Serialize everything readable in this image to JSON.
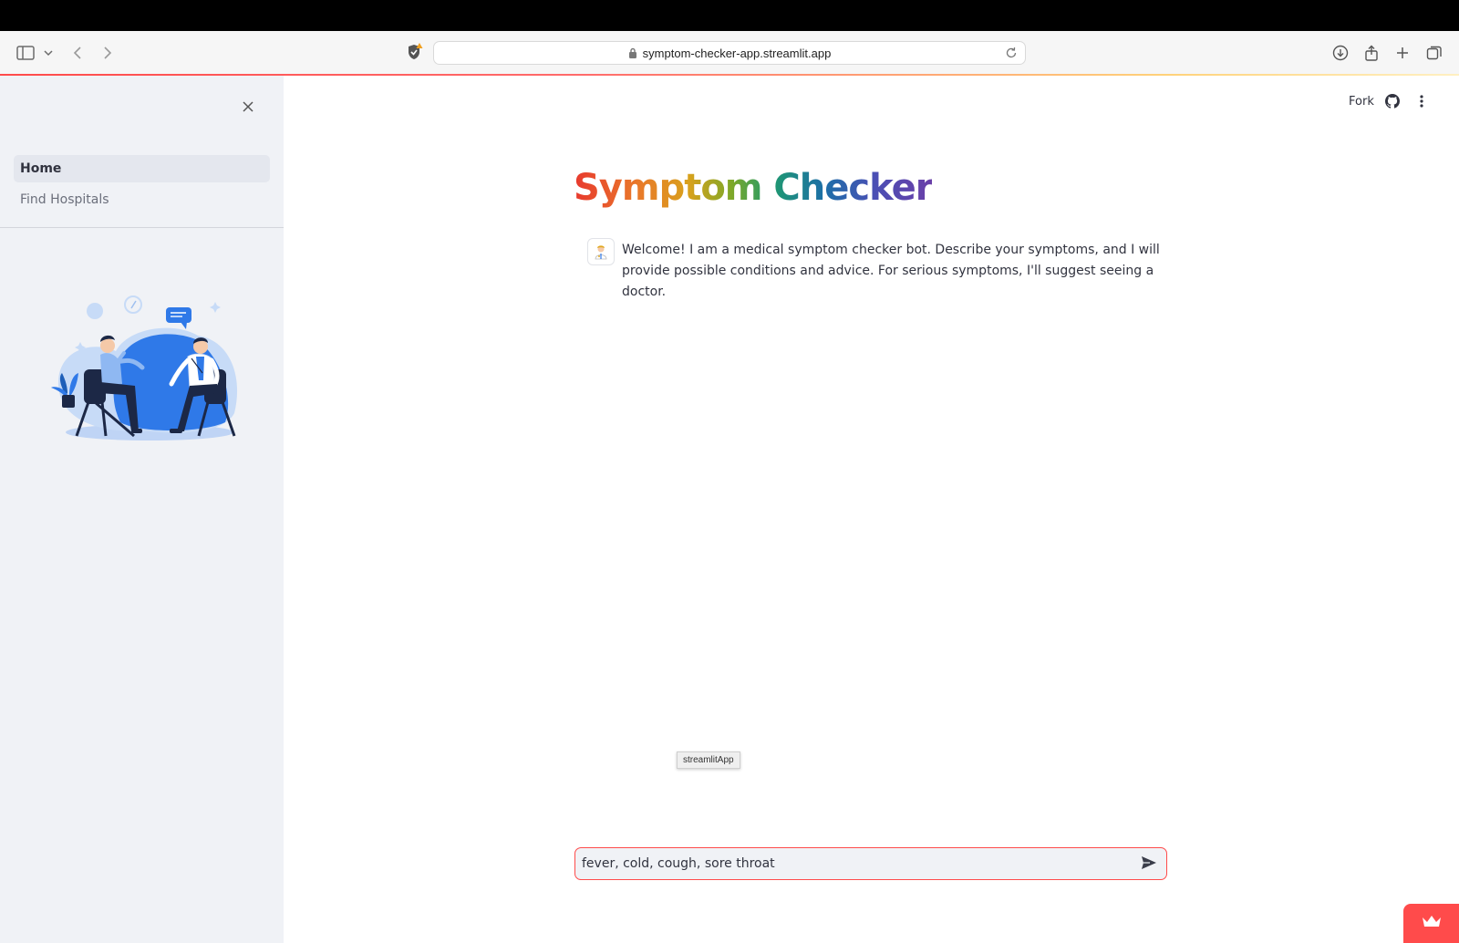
{
  "browser": {
    "url": "symptom-checker-app.streamlit.app",
    "icons": [
      "sidebar-toggle-icon",
      "chevron-down-icon",
      "back-icon",
      "forward-icon",
      "shield-icon",
      "lock-icon",
      "reload-icon",
      "download-icon",
      "share-icon",
      "new-tab-icon",
      "tabs-overview-icon"
    ]
  },
  "sidebar": {
    "nav_items": [
      {
        "label": "Home",
        "active": true
      },
      {
        "label": "Find Hospitals",
        "active": false
      }
    ]
  },
  "header": {
    "fork_label": "Fork"
  },
  "main": {
    "title": "Symptom Checker",
    "message": "Welcome! I am a medical symptom checker bot. Describe your symptoms, and I will provide possible conditions and advice. For serious symptoms, I'll suggest seeing a doctor.",
    "tooltip": "streamlitApp",
    "chat_input_value": "fever, cold, cough, sore throat"
  },
  "colors": {
    "accent": "#ff4b4b",
    "sidebar_bg": "#f0f2f6",
    "text": "#31333f"
  }
}
